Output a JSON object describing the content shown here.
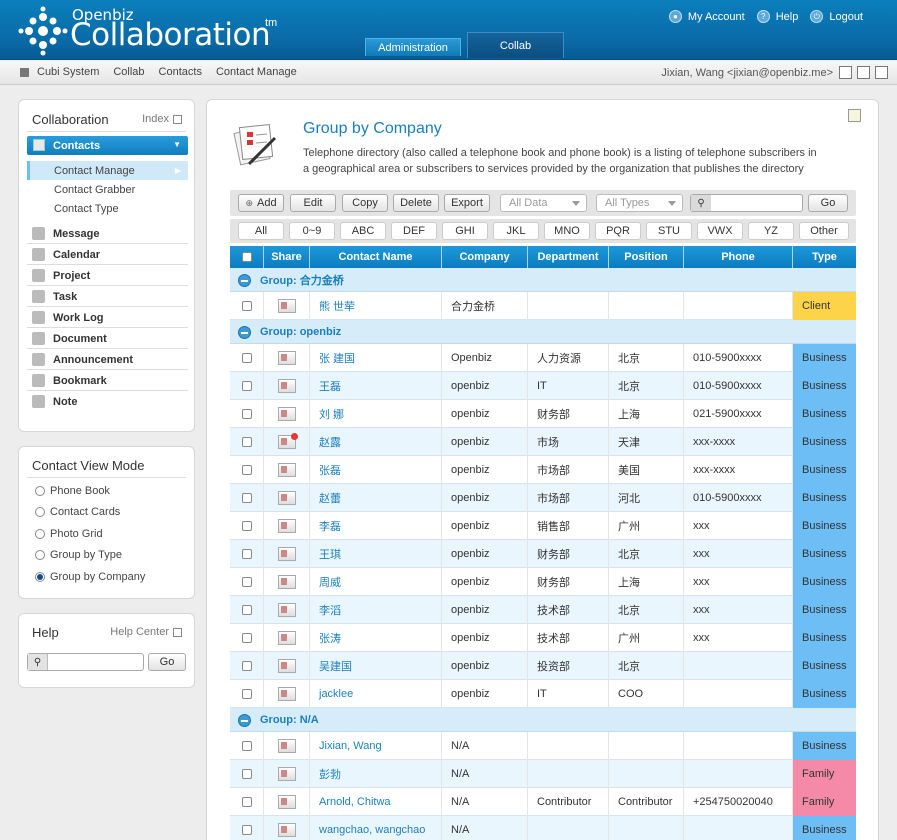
{
  "header": {
    "brand_small": "Openbiz",
    "brand_big": "Collaboration",
    "brand_tm": "tm",
    "links": [
      {
        "label": "My Account",
        "icon": "user-icon"
      },
      {
        "label": "Help",
        "icon": "help-icon"
      },
      {
        "label": "Logout",
        "icon": "power-icon"
      }
    ],
    "tabs": [
      "Administration",
      "Collab"
    ]
  },
  "breadcrumb": [
    "Cubi System",
    "Collab",
    "Contacts",
    "Contact Manage"
  ],
  "user": "Jixian, Wang <jixian@openbiz.me>",
  "sidebar": {
    "title": "Collaboration",
    "index_label": "Index",
    "contacts_label": "Contacts",
    "contacts_sub": [
      "Contact Manage",
      "Contact Grabber",
      "Contact Type"
    ],
    "menu": [
      "Message",
      "Calendar",
      "Project",
      "Task",
      "Work Log",
      "Document",
      "Announcement",
      "Bookmark",
      "Note"
    ]
  },
  "viewmode": {
    "title": "Contact View Mode",
    "options": [
      "Phone Book",
      "Contact Cards",
      "Photo Grid",
      "Group by Type",
      "Group by Company"
    ],
    "selected": "Group by Company"
  },
  "help": {
    "title": "Help",
    "center_label": "Help Center",
    "go": "Go"
  },
  "main": {
    "title": "Group by Company",
    "desc": "Telephone directory (also called a telephone book and phone book) is a listing of telephone subscribers in a geographical area or subscribers to services provided by the organization that publishes the directory"
  },
  "toolbar": {
    "buttons": [
      "Add",
      "Edit",
      "Copy",
      "Delete",
      "Export"
    ],
    "data_filter": "All Data",
    "type_filter": "All Types",
    "go": "Go"
  },
  "alpha": [
    "All",
    "0~9",
    "ABC",
    "DEF",
    "GHI",
    "JKL",
    "MNO",
    "PQR",
    "STU",
    "VWX",
    "YZ",
    "Other"
  ],
  "columns": [
    "Share",
    "Contact Name",
    "Company",
    "Department",
    "Position",
    "Phone",
    "Type"
  ],
  "colors": {
    "client": "#fdd34a",
    "business": "#6cbef5",
    "family": "#f58aa8",
    "accent": "#1a7fbf"
  },
  "groups": [
    {
      "label": "Group: 合力金桥",
      "rows": [
        {
          "name": "熊 世荦",
          "company": "合力金桥",
          "dept": "",
          "pos": "",
          "phone": "",
          "type": "Client",
          "star": false
        }
      ]
    },
    {
      "label": "Group: openbiz",
      "rows": [
        {
          "name": "张 建国",
          "company": "Openbiz",
          "dept": "人力资源",
          "pos": "北京",
          "phone": "010-5900xxxx",
          "type": "Business",
          "star": false
        },
        {
          "name": "王磊",
          "company": "openbiz",
          "dept": "IT",
          "pos": "北京",
          "phone": "010-5900xxxx",
          "type": "Business",
          "star": false
        },
        {
          "name": "刘 娜",
          "company": "openbiz",
          "dept": "财务部",
          "pos": "上海",
          "phone": "021-5900xxxx",
          "type": "Business",
          "star": false
        },
        {
          "name": "赵露",
          "company": "openbiz",
          "dept": "市场",
          "pos": "天津",
          "phone": "xxx-xxxx",
          "type": "Business",
          "star": true
        },
        {
          "name": "张磊",
          "company": "openbiz",
          "dept": "市场部",
          "pos": "美国",
          "phone": "xxx-xxxx",
          "type": "Business",
          "star": false
        },
        {
          "name": "赵蕾",
          "company": "openbiz",
          "dept": "市场部",
          "pos": "河北",
          "phone": "010-5900xxxx",
          "type": "Business",
          "star": false
        },
        {
          "name": "李磊",
          "company": "openbiz",
          "dept": "销售部",
          "pos": "广州",
          "phone": "xxx",
          "type": "Business",
          "star": false
        },
        {
          "name": "王琪",
          "company": "openbiz",
          "dept": "财务部",
          "pos": "北京",
          "phone": "xxx",
          "type": "Business",
          "star": false
        },
        {
          "name": "周威",
          "company": "openbiz",
          "dept": "财务部",
          "pos": "上海",
          "phone": "xxx",
          "type": "Business",
          "star": false
        },
        {
          "name": "李滔",
          "company": "openbiz",
          "dept": "技术部",
          "pos": "北京",
          "phone": "xxx",
          "type": "Business",
          "star": false
        },
        {
          "name": "张涛",
          "company": "openbiz",
          "dept": "技术部",
          "pos": "广州",
          "phone": "xxx",
          "type": "Business",
          "star": false
        },
        {
          "name": "吴建国",
          "company": "openbiz",
          "dept": "投资部",
          "pos": "北京",
          "phone": "",
          "type": "Business",
          "star": false
        },
        {
          "name": "jacklee",
          "company": "openbiz",
          "dept": "IT",
          "pos": "COO",
          "phone": "",
          "type": "Business",
          "star": false
        }
      ]
    },
    {
      "label": "Group: N/A",
      "rows": [
        {
          "name": "Jixian, Wang",
          "company": "N/A",
          "dept": "",
          "pos": "",
          "phone": "",
          "type": "Business",
          "star": false
        },
        {
          "name": "彭勃",
          "company": "N/A",
          "dept": "",
          "pos": "",
          "phone": "",
          "type": "Family",
          "star": false
        },
        {
          "name": "Arnold, Chitwa",
          "company": "N/A",
          "dept": "Contributor",
          "pos": "Contributor",
          "phone": "+254750020040",
          "type": "Family",
          "star": false
        },
        {
          "name": "wangchao, wangchao",
          "company": "N/A",
          "dept": "",
          "pos": "",
          "phone": "",
          "type": "Business",
          "star": false
        }
      ]
    }
  ]
}
